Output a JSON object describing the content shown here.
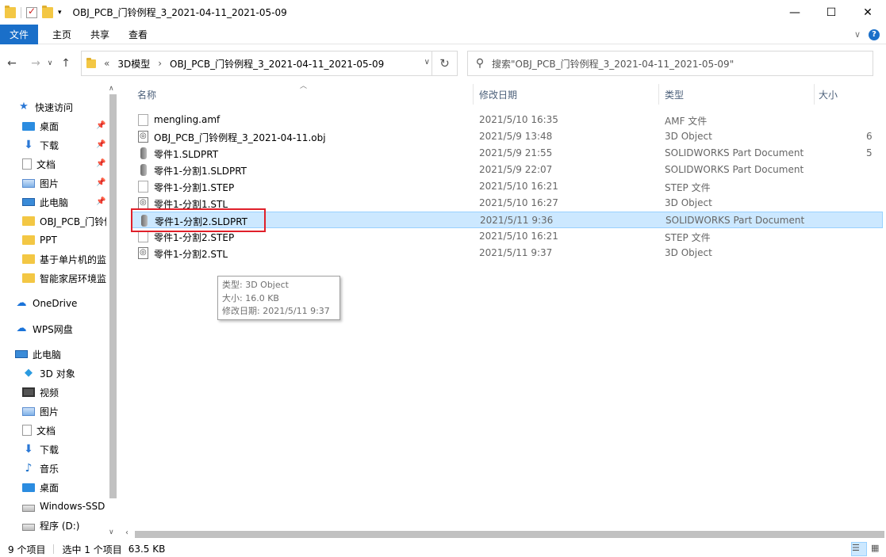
{
  "window": {
    "title": "OBJ_PCB_门铃例程_3_2021-04-11_2021-05-09",
    "minimize_glyph": "—",
    "maximize_glyph": "☐",
    "close_glyph": "✕"
  },
  "ribbon": {
    "tabs": [
      "文件",
      "主页",
      "共享",
      "查看"
    ],
    "expand_glyph": "∨",
    "help_glyph": "?"
  },
  "address": {
    "back_glyph": "←",
    "forward_glyph": "→",
    "recent_glyph": "∨",
    "up_glyph": "↑",
    "overflow": "«",
    "crumbs": [
      "3D模型",
      "OBJ_PCB_门铃例程_3_2021-04-11_2021-05-09"
    ],
    "crumb_separator": "›",
    "dropdown_glyph": "∨",
    "refresh_glyph": "↻"
  },
  "search": {
    "placeholder": "搜索\"OBJ_PCB_门铃例程_3_2021-04-11_2021-05-09\"",
    "icon_glyph": "⚲"
  },
  "sidebar": {
    "items": [
      {
        "label": "快速访问",
        "icon": "star-icon"
      },
      {
        "label": "桌面",
        "icon": "desktop-icon",
        "pinned": true
      },
      {
        "label": "下载",
        "icon": "download-icon",
        "pinned": true
      },
      {
        "label": "文档",
        "icon": "document-icon",
        "pinned": true
      },
      {
        "label": "图片",
        "icon": "picture-icon",
        "pinned": true
      },
      {
        "label": "此电脑",
        "icon": "pc-icon",
        "pinned": true
      },
      {
        "label": "OBJ_PCB_门铃例",
        "icon": "folder-icon"
      },
      {
        "label": "PPT",
        "icon": "folder-icon"
      },
      {
        "label": "基于单片机的监",
        "icon": "folder-icon"
      },
      {
        "label": "智能家居环境监",
        "icon": "folder-icon"
      },
      {
        "label": "OneDrive",
        "icon": "cloud-icon"
      },
      {
        "label": "WPS网盘",
        "icon": "cloud-icon"
      },
      {
        "label": "此电脑",
        "icon": "pc-icon"
      },
      {
        "label": "3D 对象",
        "icon": "3d-objects-icon"
      },
      {
        "label": "视频",
        "icon": "video-icon"
      },
      {
        "label": "图片",
        "icon": "picture-icon"
      },
      {
        "label": "文档",
        "icon": "document-icon"
      },
      {
        "label": "下载",
        "icon": "download-icon"
      },
      {
        "label": "音乐",
        "icon": "music-icon"
      },
      {
        "label": "桌面",
        "icon": "desktop-icon"
      },
      {
        "label": "Windows-SSD",
        "icon": "drive-icon"
      },
      {
        "label": "程序 (D:)",
        "icon": "drive-icon"
      }
    ],
    "pin_glyph": "📌"
  },
  "columns": {
    "name": "名称",
    "date": "修改日期",
    "type": "类型",
    "size": "大小"
  },
  "files": [
    {
      "name": "mengling.amf",
      "date": "2021/5/10 16:35",
      "type": "AMF 文件",
      "size": "",
      "icon": "file-icon"
    },
    {
      "name": "OBJ_PCB_门铃例程_3_2021-04-11.obj",
      "date": "2021/5/9 13:48",
      "type": "3D Object",
      "size": "6",
      "icon": "3d-object-file-icon"
    },
    {
      "name": "零件1.SLDPRT",
      "date": "2021/5/9 21:55",
      "type": "SOLIDWORKS Part Document",
      "size": "5",
      "icon": "solidworks-part-icon"
    },
    {
      "name": "零件1-分割1.SLDPRT",
      "date": "2021/5/9 22:07",
      "type": "SOLIDWORKS Part Document",
      "size": "",
      "icon": "solidworks-part-icon"
    },
    {
      "name": "零件1-分割1.STEP",
      "date": "2021/5/10 16:21",
      "type": "STEP 文件",
      "size": "",
      "icon": "file-icon"
    },
    {
      "name": "零件1-分割1.STL",
      "date": "2021/5/10 16:27",
      "type": "3D Object",
      "size": "",
      "icon": "3d-object-file-icon"
    },
    {
      "name": "零件1-分割2.SLDPRT",
      "date": "2021/5/11 9:36",
      "type": "SOLIDWORKS Part Document",
      "size": "",
      "icon": "solidworks-part-icon",
      "selected": true
    },
    {
      "name": "零件1-分割2.STEP",
      "date": "2021/5/10 16:21",
      "type": "STEP 文件",
      "size": "",
      "icon": "file-icon"
    },
    {
      "name": "零件1-分割2.STL",
      "date": "2021/5/11 9:37",
      "type": "3D Object",
      "size": "",
      "icon": "3d-object-file-icon"
    }
  ],
  "tooltip": {
    "type_line": "类型: 3D Object",
    "size_line": "大小: 16.0 KB",
    "date_line": "修改日期: 2021/5/11 9:37"
  },
  "status": {
    "item_count": "9 个项目",
    "selected": "选中 1 个项目",
    "selected_size": "63.5 KB"
  },
  "colors": {
    "accent": "#1a6fc9",
    "selection": "#cce8ff",
    "highlight_box": "#e0202a"
  }
}
